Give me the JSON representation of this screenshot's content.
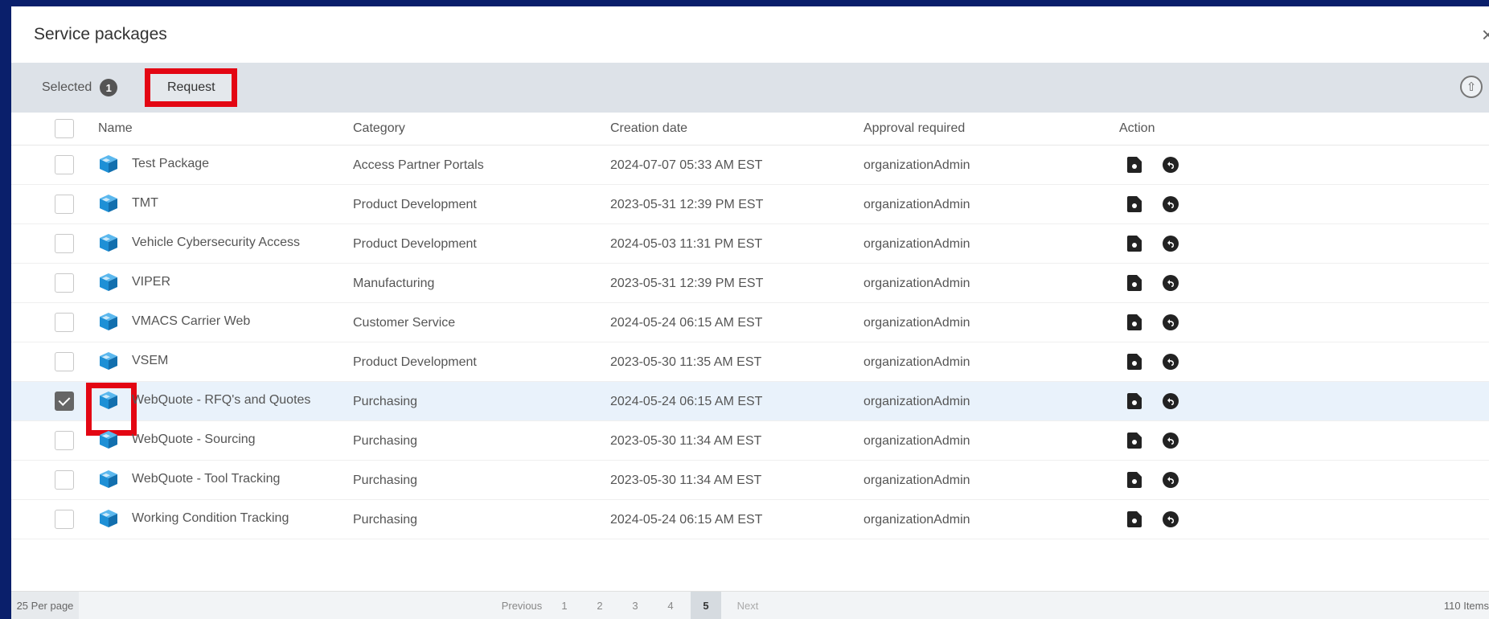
{
  "dialog": {
    "title": "Service packages",
    "close_label": "×"
  },
  "toolbar": {
    "selected_label": "Selected",
    "selected_count": "1",
    "request_label": "Request"
  },
  "table": {
    "headers": {
      "name": "Name",
      "category": "Category",
      "creation_date": "Creation date",
      "approval_required": "Approval required",
      "action": "Action"
    },
    "rows": [
      {
        "name": "Test Package",
        "category": "Access Partner Portals",
        "date": "2024-07-07 05:33 AM EST",
        "approval": "organizationAdmin",
        "checked": false
      },
      {
        "name": "TMT",
        "category": "Product Development",
        "date": "2023-05-31 12:39 PM EST",
        "approval": "organizationAdmin",
        "checked": false
      },
      {
        "name": "Vehicle Cybersecurity Access",
        "category": "Product Development",
        "date": "2024-05-03 11:31 PM EST",
        "approval": "organizationAdmin",
        "checked": false
      },
      {
        "name": "VIPER",
        "category": "Manufacturing",
        "date": "2023-05-31 12:39 PM EST",
        "approval": "organizationAdmin",
        "checked": false
      },
      {
        "name": "VMACS Carrier Web",
        "category": "Customer Service",
        "date": "2024-05-24 06:15 AM EST",
        "approval": "organizationAdmin",
        "checked": false
      },
      {
        "name": "VSEM",
        "category": "Product Development",
        "date": "2023-05-30 11:35 AM EST",
        "approval": "organizationAdmin",
        "checked": false
      },
      {
        "name": "WebQuote - RFQ's and Quotes",
        "category": "Purchasing",
        "date": "2024-05-24 06:15 AM EST",
        "approval": "organizationAdmin",
        "checked": true
      },
      {
        "name": "WebQuote - Sourcing",
        "category": "Purchasing",
        "date": "2023-05-30 11:34 AM EST",
        "approval": "organizationAdmin",
        "checked": false
      },
      {
        "name": "WebQuote - Tool Tracking",
        "category": "Purchasing",
        "date": "2023-05-30 11:34 AM EST",
        "approval": "organizationAdmin",
        "checked": false
      },
      {
        "name": "Working Condition Tracking",
        "category": "Purchasing",
        "date": "2024-05-24 06:15 AM EST",
        "approval": "organizationAdmin",
        "checked": false
      }
    ]
  },
  "footer": {
    "per_page": "25 Per page",
    "previous": "Previous",
    "pages": [
      "1",
      "2",
      "3",
      "4",
      "5"
    ],
    "current_page": "5",
    "next": "Next",
    "items_count": "110 Items"
  },
  "colors": {
    "background": "#0a1f6b",
    "highlight": "#e30613",
    "package_icon": "#1e90d6",
    "selected_row": "#e9f2fb"
  },
  "icons": {
    "package": "cube-package-icon",
    "doc_action": "document-icon",
    "undo_action": "undo-icon",
    "scroll_top": "scroll-top-icon"
  }
}
